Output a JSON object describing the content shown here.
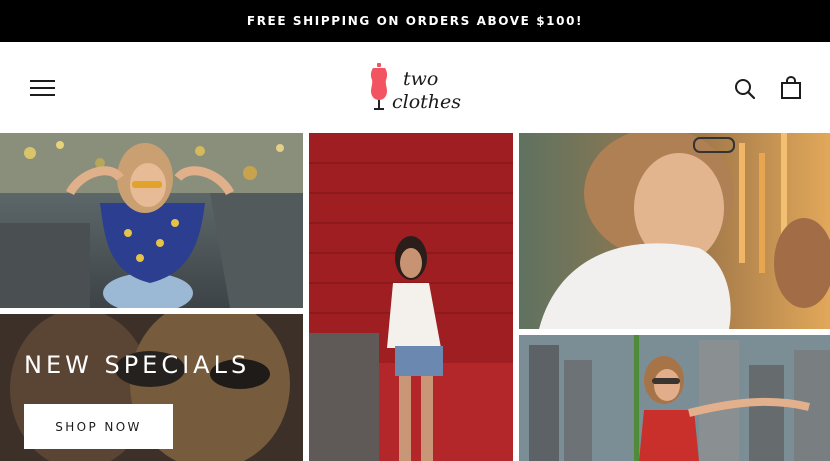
{
  "announcement": {
    "text": "FREE SHIPPING ON ORDERS ABOVE $100!"
  },
  "header": {
    "logo": {
      "line1": "two",
      "line2": "clothes",
      "icon": "dress-form-icon",
      "icon_color": "#f25461"
    },
    "icons": {
      "menu": "hamburger-menu-icon",
      "search": "search-icon",
      "cart": "shopping-bag-icon"
    }
  },
  "hero": {
    "title": "NEW SPECIALS",
    "cta_label": "SHOP NOW"
  },
  "colors": {
    "announcement_bg": "#000000",
    "announcement_text": "#ffffff",
    "brand_accent": "#f25461",
    "text_dark": "#1c1c1c"
  }
}
